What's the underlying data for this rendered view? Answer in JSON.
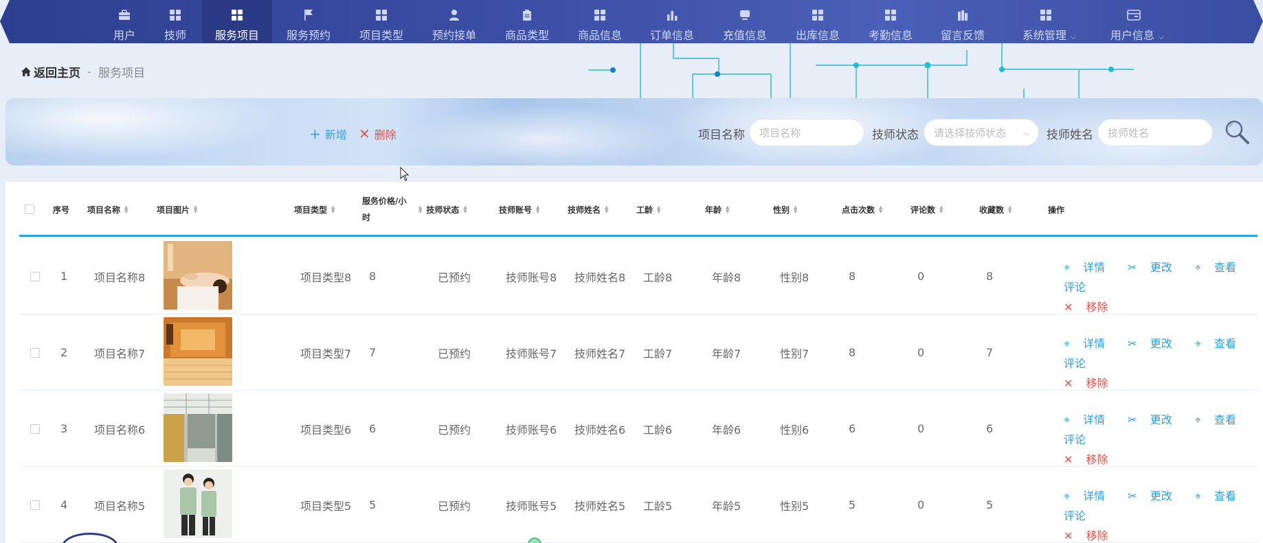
{
  "nav": {
    "items": [
      {
        "label": "用户",
        "icon": "briefcase-icon"
      },
      {
        "label": "技师",
        "icon": "grid-icon"
      },
      {
        "label": "服务项目",
        "icon": "grid-icon"
      },
      {
        "label": "服务预约",
        "icon": "flag-icon"
      },
      {
        "label": "项目类型",
        "icon": "grid-icon"
      },
      {
        "label": "预约接单",
        "icon": "user-icon"
      },
      {
        "label": "商品类型",
        "icon": "clipboard-icon"
      },
      {
        "label": "商品信息",
        "icon": "grid-icon"
      },
      {
        "label": "订单信息",
        "icon": "bar-chart-icon"
      },
      {
        "label": "充值信息",
        "icon": "monitor-icon"
      },
      {
        "label": "出库信息",
        "icon": "grid-icon"
      },
      {
        "label": "考勤信息",
        "icon": "grid-icon"
      },
      {
        "label": "留言反馈",
        "icon": "building-icon"
      },
      {
        "label": "系统管理",
        "icon": "grid-icon"
      },
      {
        "label": "用户信息",
        "icon": "card-icon"
      }
    ],
    "active": "服务项目",
    "nav_bg": "#3b4ea5",
    "active_bg": "#2a3a85"
  },
  "breadcrumb": {
    "home": "返回主页",
    "separator": "-",
    "current": "服务项目"
  },
  "toolbar": {
    "add_label": "新增",
    "delete_label": "删除"
  },
  "search": {
    "name_label": "项目名称",
    "name_placeholder": "项目名称",
    "status_label": "技师状态",
    "status_placeholder": "请选择技师状态",
    "tech_label": "技师姓名",
    "tech_placeholder": "技师姓名"
  },
  "table": {
    "headers": {
      "index": "序号",
      "name": "项目名称",
      "image": "项目图片",
      "type": "项目类型",
      "price_line1": "服务价格/小",
      "price_line2": "时",
      "status": "技师状态",
      "account": "技师账号",
      "tech_name": "技师姓名",
      "seniority": "工龄",
      "age": "年龄",
      "gender": "性别",
      "clicks": "点击次数",
      "comments": "评论数",
      "favorites": "收藏数",
      "actions": "操作"
    },
    "rows": [
      {
        "index": "1",
        "name": "项目名称8",
        "image": "massage-photo",
        "type": "项目类型8",
        "price": "8",
        "status": "已预约",
        "account": "技师账号8",
        "tech_name": "技师姓名8",
        "seniority": "工龄8",
        "age": "年龄8",
        "gender": "性别8",
        "clicks": "8",
        "comments": "0",
        "favorites": "8"
      },
      {
        "index": "2",
        "name": "项目名称7",
        "image": "sauna-photo",
        "type": "项目类型7",
        "price": "7",
        "status": "已预约",
        "account": "技师账号7",
        "tech_name": "技师姓名7",
        "seniority": "工龄7",
        "age": "年龄7",
        "gender": "性别7",
        "clicks": "8",
        "comments": "0",
        "favorites": "7"
      },
      {
        "index": "3",
        "name": "项目名称6",
        "image": "bathroom-photo",
        "type": "项目类型6",
        "price": "6",
        "status": "已预约",
        "account": "技师账号6",
        "tech_name": "技师姓名6",
        "seniority": "工龄6",
        "age": "年龄6",
        "gender": "性别6",
        "clicks": "6",
        "comments": "0",
        "favorites": "6"
      },
      {
        "index": "4",
        "name": "项目名称5",
        "image": "staff-photo",
        "type": "项目类型5",
        "price": "5",
        "status": "已预约",
        "account": "技师账号5",
        "tech_name": "技师姓名5",
        "seniority": "工龄5",
        "age": "年龄5",
        "gender": "性别5",
        "clicks": "5",
        "comments": "0",
        "favorites": "5"
      }
    ],
    "actions": {
      "detail": "详情",
      "edit": "更改",
      "view_comments": "查看评论",
      "remove": "移除"
    },
    "accent": "#2aa3e0"
  }
}
